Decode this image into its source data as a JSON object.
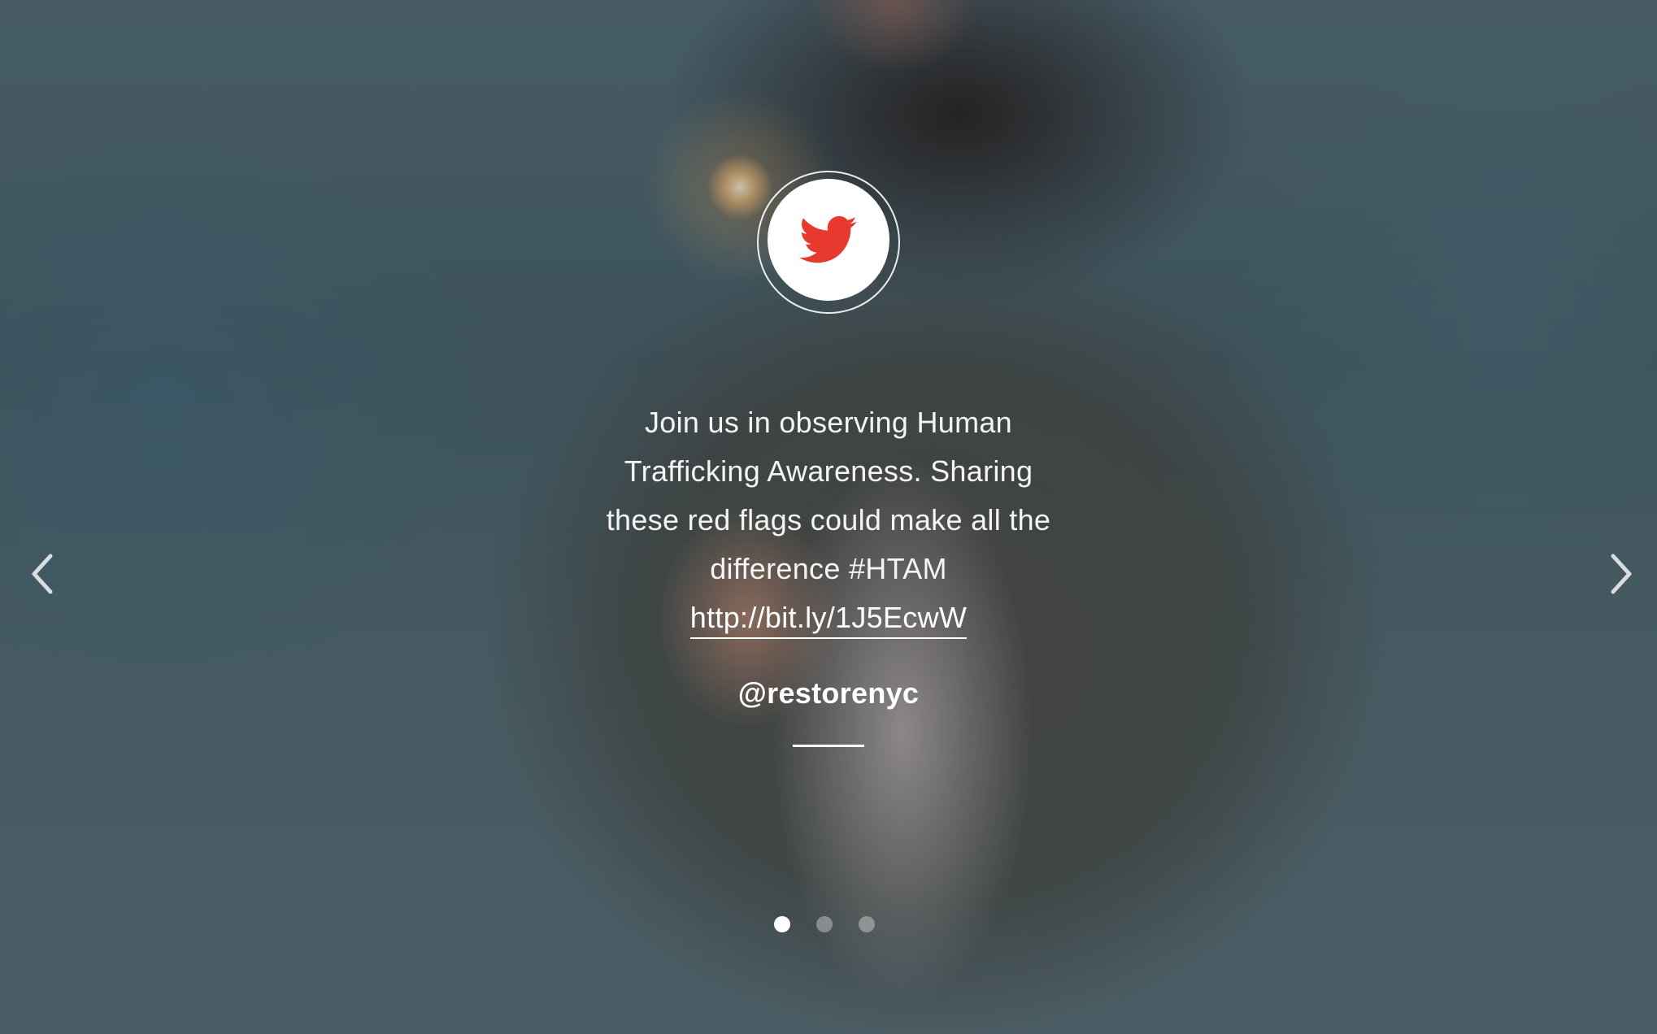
{
  "slider": {
    "tweet": {
      "lines": [
        "Join us in observing Human",
        "Trafficking Awareness. Sharing",
        "these red flags could make all the",
        "difference #HTAM"
      ],
      "link": "http://bit.ly/1J5EcwW",
      "handle": "@restorenyc"
    },
    "icons": {
      "logo": "twitter-bird-icon",
      "prev": "chevron-left-icon",
      "next": "chevron-right-icon"
    },
    "pagination": {
      "count": 3,
      "active_index": 0
    },
    "colors": {
      "accent": "#e8392f",
      "text": "#ffffff"
    }
  }
}
